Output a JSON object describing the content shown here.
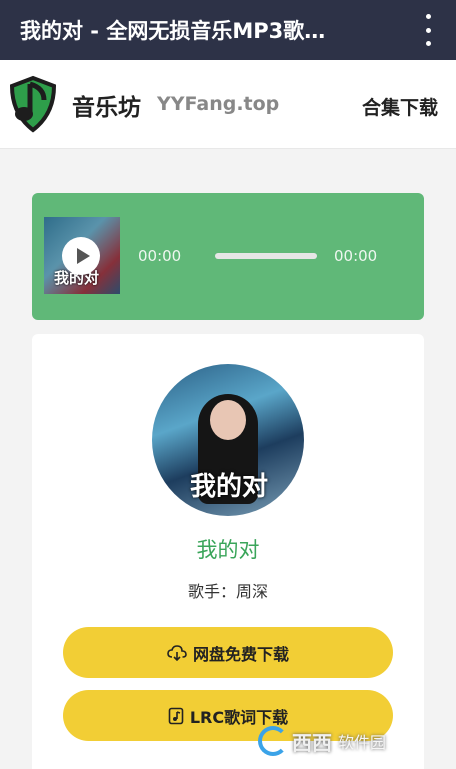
{
  "topbar": {
    "title": "我的对 - 全网无损音乐MP3歌…",
    "menu_icon": "more-vertical-icon"
  },
  "header": {
    "site_name": "音乐坊",
    "site_domain": "YYFang.top",
    "collection_link": "合集下载",
    "logo_icon": "music-note-shield-icon",
    "accent_color": "#2e9e4a"
  },
  "player": {
    "cover_text": "我的对",
    "current_time": "00:00",
    "duration": "00:00",
    "progress": 0,
    "background_color": "#60b878"
  },
  "song": {
    "cover_text": "我的对",
    "title": "我的对",
    "singer": "歌手：周深"
  },
  "actions": {
    "netdisk_download": "网盘免费下载",
    "lrc_download": "LRC歌词下载",
    "button_color": "#f2ce35"
  },
  "watermark": {
    "brand": "西西",
    "sub": "软件园"
  }
}
